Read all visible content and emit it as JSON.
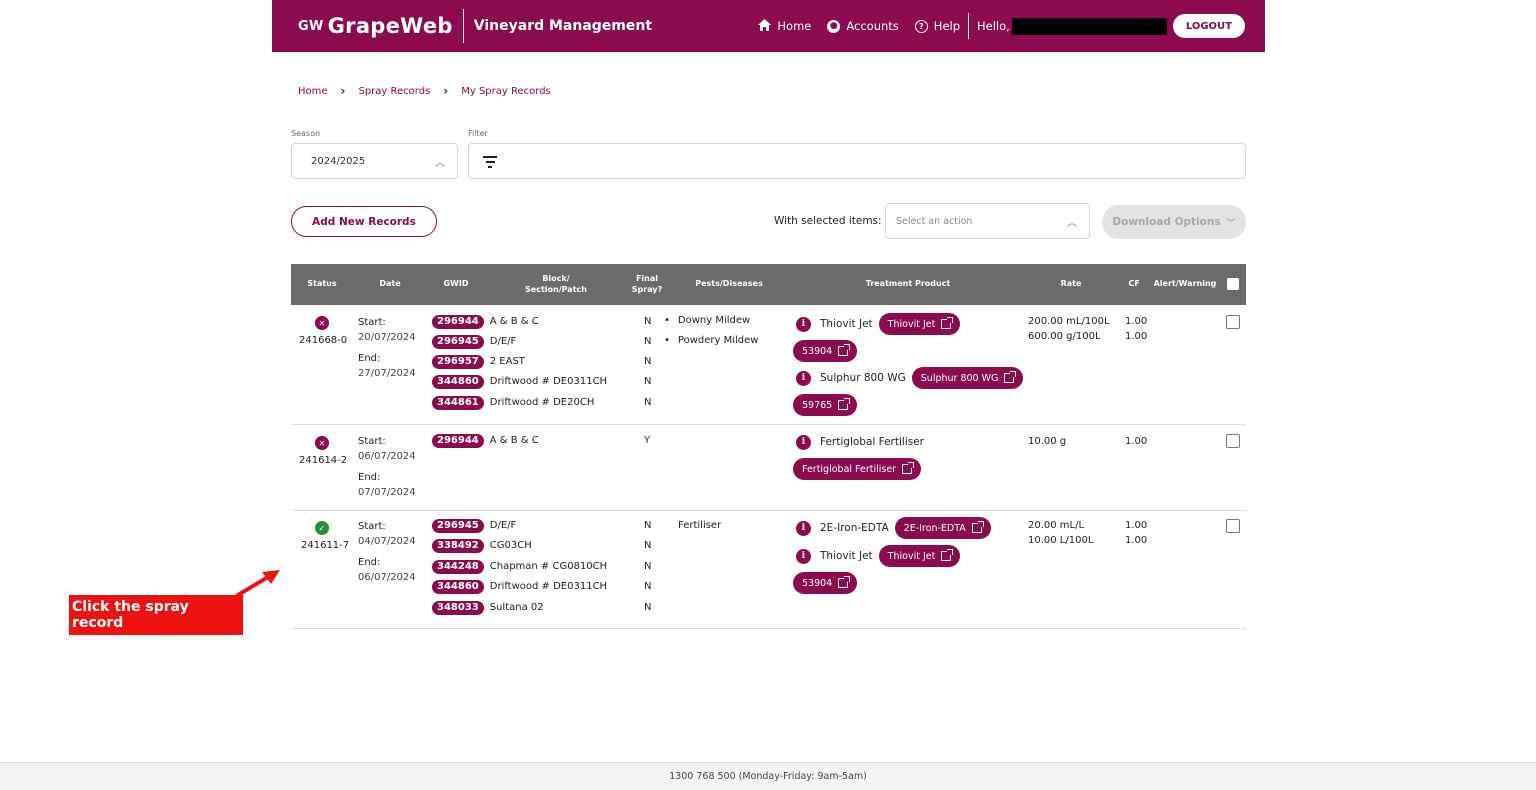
{
  "header": {
    "logo_mark": "GW",
    "logo_text": "GrapeWeb",
    "app_title": "Vineyard Management",
    "nav": {
      "home": "Home",
      "accounts": "Accounts",
      "help": "Help"
    },
    "hello": "Hello,",
    "logout": "LOGOUT",
    "icons": {
      "home": "home-icon",
      "accounts": "user-circle-icon",
      "help": "help-circle-icon"
    }
  },
  "breadcrumb": [
    "Home",
    "Spray Records",
    "My Spray Records"
  ],
  "filters": {
    "season_label": "Season",
    "season_value": "2024/2025",
    "filter_label": "Filter",
    "filter_placeholder": ""
  },
  "actions": {
    "add_new": "Add New Records",
    "with_selected": "With selected items:",
    "select_action_placeholder": "Select an action",
    "download": "Download Options"
  },
  "table": {
    "columns": {
      "status": "Status",
      "date": "Date",
      "gwid": "GWID",
      "block_l1": "Block/",
      "block_l2": "Section/Patch",
      "final_l1": "Final",
      "final_l2": "Spray?",
      "pests": "Pests/Diseases",
      "treatment": "Treatment Product",
      "rate": "Rate",
      "cf": "CF",
      "alert": "Alert/Warning"
    },
    "rows": [
      {
        "status": "error",
        "id": "241668-0",
        "start_label": "Start:",
        "start": "20/07/2024",
        "end_label": "End:",
        "end": "27/07/2024",
        "gwids": [
          {
            "id": "296944",
            "block": "A & B & C",
            "final": "N"
          },
          {
            "id": "296945",
            "block": "D/E/F",
            "final": "N"
          },
          {
            "id": "296957",
            "block": "2 EAST",
            "final": "N"
          },
          {
            "id": "344860",
            "block": "Driftwood # DE0311CH",
            "final": "N"
          },
          {
            "id": "344861",
            "block": "Driftwood # DE20CH",
            "final": "N"
          }
        ],
        "pests": [
          "Downy Mildew",
          "Powdery Mildew"
        ],
        "treatments": [
          {
            "name": "Thiovit Jet",
            "link": "Thiovit Jet",
            "code": "53904"
          },
          {
            "name": "Sulphur 800 WG",
            "link": "Sulphur 800 WG",
            "code": "59765"
          }
        ],
        "rates": [
          "200.00 mL/100L",
          "600.00 g/100L"
        ],
        "cf": [
          "1.00",
          "1.00"
        ]
      },
      {
        "status": "error",
        "id": "241614-2",
        "start_label": "Start:",
        "start": "06/07/2024",
        "end_label": "End:",
        "end": "07/07/2024",
        "gwids": [
          {
            "id": "296944",
            "block": "A & B & C",
            "final": "Y"
          }
        ],
        "pests": [],
        "treatments": [
          {
            "name": "Fertiglobal Fertiliser",
            "link": "Fertiglobal Fertiliser"
          }
        ],
        "rates": [
          "10.00 g"
        ],
        "cf": [
          "1.00"
        ]
      },
      {
        "status": "ok",
        "id": "241611-7",
        "start_label": "Start:",
        "start": "04/07/2024",
        "end_label": "End:",
        "end": "06/07/2024",
        "gwids": [
          {
            "id": "296945",
            "block": "D/E/F",
            "final": "N"
          },
          {
            "id": "338492",
            "block": "CG03CH",
            "final": "N"
          },
          {
            "id": "344248",
            "block": "Chapman # CG0810CH",
            "final": "N"
          },
          {
            "id": "344860",
            "block": "Driftwood # DE0311CH",
            "final": "N"
          },
          {
            "id": "348033",
            "block": "Sultana 02",
            "final": "N"
          }
        ],
        "pests": [
          "Fertiliser"
        ],
        "treatments": [
          {
            "name": "2E-Iron-EDTA",
            "link": "2E-Iron-EDTA"
          },
          {
            "name": "Thiovit Jet",
            "link": "Thiovit Jet",
            "code": "53904"
          }
        ],
        "rates": [
          "20.00 mL/L",
          "10.00 L/100L"
        ],
        "cf": [
          "1.00",
          "1.00"
        ]
      }
    ]
  },
  "annotation": {
    "text": "Click the spray record"
  },
  "footer": {
    "text": "1300 768 500 (Monday-Friday: 9am-5am)"
  },
  "colors": {
    "brand": "#8c0a4e",
    "header_row": "#6b6b6b",
    "ok": "#2e8b3e",
    "callout": "#ee1111"
  }
}
